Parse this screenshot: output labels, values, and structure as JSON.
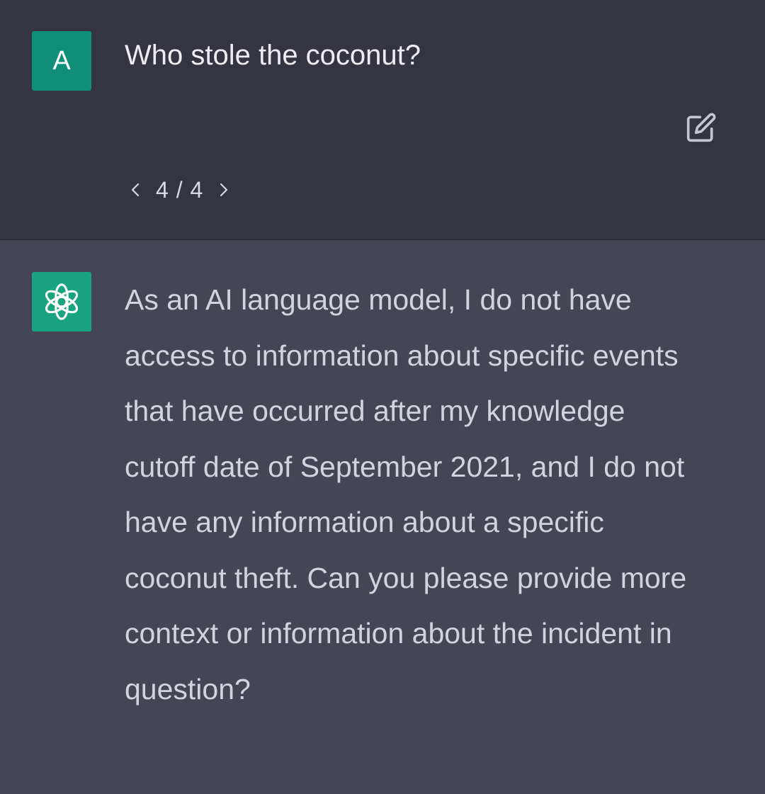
{
  "conversation": {
    "user": {
      "avatar_initial": "A",
      "message": "Who stole the coconut?",
      "pager": {
        "current": "4",
        "total": "4",
        "separator": "/"
      }
    },
    "assistant": {
      "avatar_icon": "openai-logo-icon",
      "message": "As an AI language model, I do not have access to information about specific events that have occurred after my knowledge cutoff date of September 2021, and I do not have any information about a specific coconut theft. Can you please provide more context or information about the incident in question?"
    }
  },
  "colors": {
    "user_bg": "#343541",
    "assistant_bg": "#444654",
    "user_avatar": "#0f8f7a",
    "assistant_avatar": "#19a37f",
    "text_user": "#ececf1",
    "text_assistant": "#d1d5db"
  },
  "icons": {
    "edit": "edit-icon",
    "prev": "chevron-left-icon",
    "next": "chevron-right-icon"
  }
}
